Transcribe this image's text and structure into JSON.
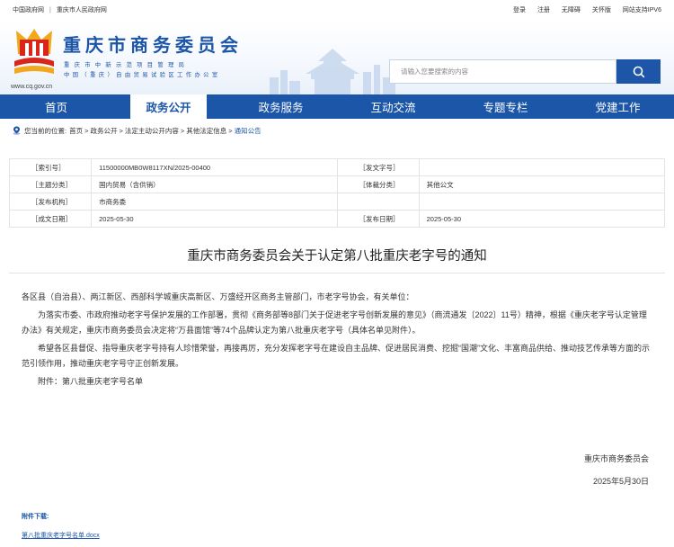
{
  "topbar": {
    "left_links": [
      "中国政府网",
      "重庆市人民政府网"
    ],
    "right_links": [
      "登录",
      "注册",
      "无障碍",
      "关怀版",
      "网站支持IPV6"
    ]
  },
  "header": {
    "title": "重庆市商务委员会",
    "subtitle_line1": "重庆市中新示范项目管理局",
    "subtitle_line2": "中国（重庆）自由贸易试验区工作办公室",
    "logo_url": "www.cq.gov.cn",
    "search_placeholder": "请输入您要搜索的内容",
    "colors": {
      "brand": "#1b56a8",
      "logo_red": "#d8261c",
      "logo_gold": "#f2a81d"
    }
  },
  "nav": {
    "items": [
      "首页",
      "政务公开",
      "政务服务",
      "互动交流",
      "专题专栏",
      "党建工作"
    ],
    "active": "政务公开"
  },
  "breadcrumb": {
    "prefix": "您当前的位置:",
    "items": [
      "首页",
      "政务公开",
      "法定主动公开内容",
      "其他法定信息",
      "通知公告"
    ]
  },
  "meta": {
    "rows": [
      {
        "k1": "［索引号］",
        "v1": "11500000MB0W8117XN/2025-00400",
        "k2": "［发文字号］",
        "v2": ""
      },
      {
        "k1": "［主题分类］",
        "v1": "国内贸易（含供销）",
        "k2": "［体裁分类］",
        "v2": "其他公文"
      },
      {
        "k1": "［发布机构］",
        "v1": "市商务委",
        "k2": "",
        "v2": ""
      },
      {
        "k1": "［成文日期］",
        "v1": "2025-05-30",
        "k2": "［发布日期］",
        "v2": "2025-05-30"
      }
    ]
  },
  "article": {
    "title": "重庆市商务委员会关于认定第八批重庆老字号的通知",
    "addressee": "各区县（自治县）、两江新区、西部科学城重庆高新区、万盛经开区商务主管部门，市老字号协会，有关单位：",
    "para1": "为落实市委、市政府推动老字号保护发展的工作部署，贯彻《商务部等8部门关于促进老字号创新发展的意见》（商流通发〔2022〕11号）精神，根据《重庆老字号认定管理办法》有关规定，重庆市商务委员会决定将“万县面馆”等74个品牌认定为第八批重庆老字号（具体名单见附件）。",
    "para2": "希望各区县督促、指导重庆老字号持有人珍惜荣誉，再接再厉，充分发挥老字号在建设自主品牌、促进居民消费、挖掘“国潮”文化、丰富商品供给、推动技艺传承等方面的示范引领作用，推动重庆老字号守正创新发展。",
    "attachment_note": "附件：第八批重庆老字号名单",
    "signature": "重庆市商务委员会",
    "date": "2025年5月30日",
    "attachment_label": "附件下载:",
    "attachment_file": "第八批重庆老字号名单.docx"
  },
  "icons": [
    "search-icon",
    "location-pin-icon",
    "logo-emblem"
  ]
}
